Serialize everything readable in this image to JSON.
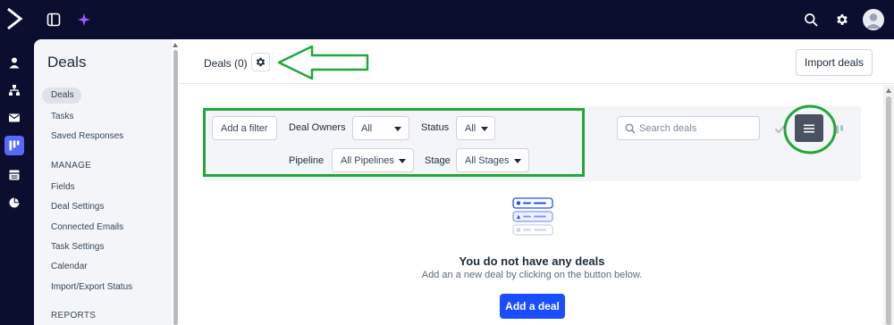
{
  "colors": {
    "accent": "#1a4dff",
    "rail_bg": "#0b0e2e",
    "annotation": "#21a83a",
    "rail_active": "#5568ff"
  },
  "topbar": {
    "icons": [
      "sidebar-toggle-icon",
      "sparkle-icon",
      "search-icon",
      "gear-icon",
      "user-avatar-icon"
    ]
  },
  "rail": {
    "icons": [
      "contacts-icon",
      "org-chart-icon",
      "mail-icon",
      "deals-board-icon",
      "calendar-list-icon",
      "reports-pie-icon"
    ],
    "active": "deals-board-icon"
  },
  "leftnav": {
    "title": "Deals",
    "items": [
      "Deals",
      "Tasks",
      "Saved Responses"
    ],
    "manage_heading": "MANAGE",
    "manage_items": [
      "Fields",
      "Deal Settings",
      "Connected Emails",
      "Task Settings",
      "Calendar",
      "Import/Export Status"
    ],
    "reports_heading": "REPORTS"
  },
  "header": {
    "title": "Deals (0)",
    "import_label": "Import deals"
  },
  "filters": {
    "add_filter": "Add a filter",
    "owners_label": "Deal Owners",
    "owners_value": "All",
    "status_label": "Status",
    "status_value": "All",
    "pipeline_label": "Pipeline",
    "pipeline_value": "All Pipelines",
    "stage_label": "Stage",
    "stage_value": "All Stages"
  },
  "search": {
    "placeholder": "Search deals"
  },
  "view_toggle": {
    "options": [
      "checkmark-icon",
      "list-view-icon",
      "kanban-view-icon"
    ],
    "active": "list-view-icon"
  },
  "empty": {
    "title": "You do not have any deals",
    "subtitle": "Add an a new deal by clicking on the button below.",
    "cta": "Add a deal"
  }
}
